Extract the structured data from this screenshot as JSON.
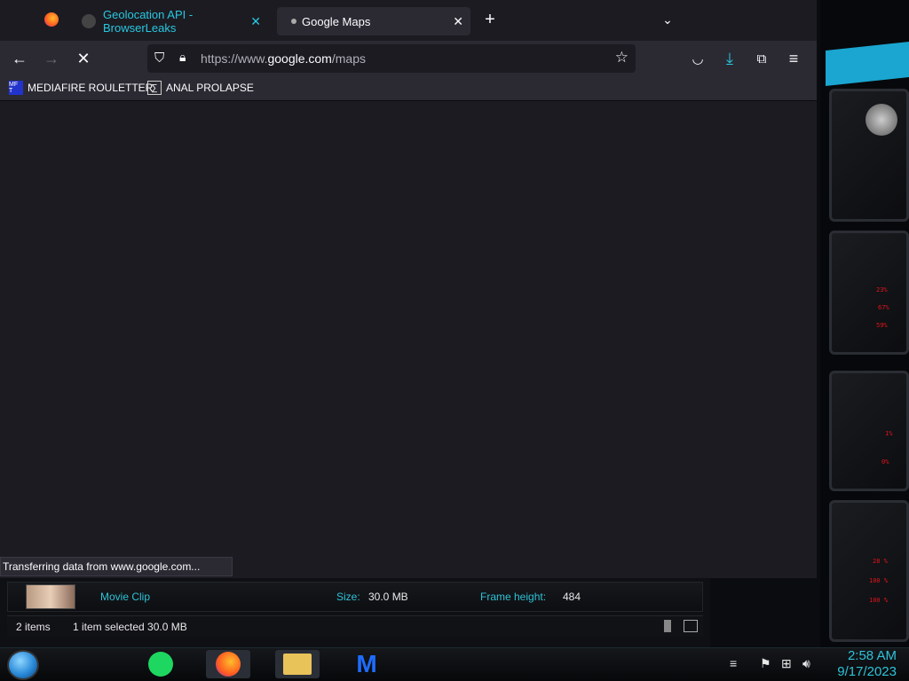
{
  "browser": {
    "tabs": [
      {
        "title": "Geolocation API - BrowserLeaks",
        "active": false
      },
      {
        "title": "Google Maps",
        "active": true
      }
    ],
    "url": {
      "prefix": "https://www.",
      "domain": "google.com",
      "path": "/maps"
    },
    "bookmarks": [
      {
        "label": "MEDIAFIRE ROULETTER",
        "icon": "MF T"
      },
      {
        "label": "ANAL PROLAPSE",
        "icon": "∑"
      }
    ],
    "status_text": "Transferring data from www.google.com..."
  },
  "explorer": {
    "details": {
      "type": "Movie Clip",
      "size_label": "Size:",
      "size_value": "30.0 MB",
      "frame_label": "Frame height:",
      "frame_value": "484"
    },
    "status": {
      "items": "2 items",
      "selected": "1 item selected  30.0 MB"
    }
  },
  "taskbar": {
    "time": "2:58 AM",
    "date": "9/17/2023"
  },
  "gadgets": {
    "readouts": [
      "23%",
      "67%",
      "59%",
      "1%",
      "0%",
      "28 %",
      "100 %",
      "100 %"
    ]
  },
  "colors": {
    "accent_cyan": "#28c8e0",
    "alert_red": "#e0141c",
    "browser_bg": "#1c1b22",
    "toolbar_bg": "#2b2a33"
  }
}
